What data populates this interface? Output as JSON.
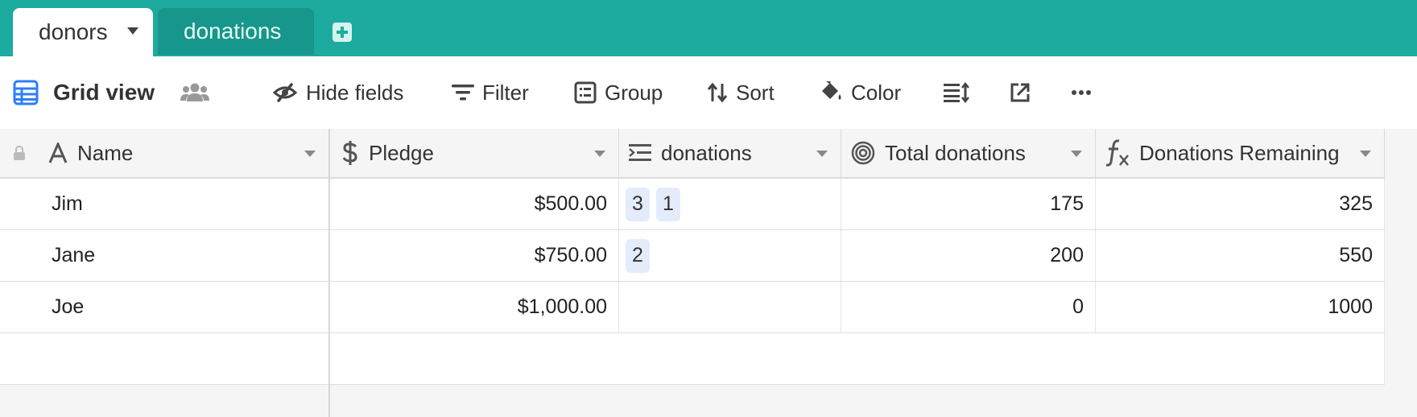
{
  "tabs": [
    {
      "label": "donors",
      "active": true
    },
    {
      "label": "donations",
      "active": false
    }
  ],
  "toolbar": {
    "view_label": "Grid view",
    "hide_fields": "Hide fields",
    "filter": "Filter",
    "group": "Group",
    "sort": "Sort",
    "color": "Color"
  },
  "columns": [
    {
      "name": "Name",
      "type_icon": "text-type-icon"
    },
    {
      "name": "Pledge",
      "type_icon": "currency-type-icon"
    },
    {
      "name": "donations",
      "type_icon": "link-type-icon"
    },
    {
      "name": "Total donations",
      "type_icon": "rollup-type-icon"
    },
    {
      "name": "Donations Remaining",
      "type_icon": "formula-type-icon"
    }
  ],
  "rows": [
    {
      "name": "Jim",
      "pledge": "$500.00",
      "donations": [
        "3",
        "1"
      ],
      "total": "175",
      "remaining": "325"
    },
    {
      "name": "Jane",
      "pledge": "$750.00",
      "donations": [
        "2"
      ],
      "total": "200",
      "remaining": "550"
    },
    {
      "name": "Joe",
      "pledge": "$1,000.00",
      "donations": [],
      "total": "0",
      "remaining": "1000"
    }
  ],
  "colors": {
    "brand": "#1cab9e",
    "brand_dark": "#17968b",
    "view_icon": "#2d7ff9",
    "link_chip": "#e4ecfb"
  }
}
